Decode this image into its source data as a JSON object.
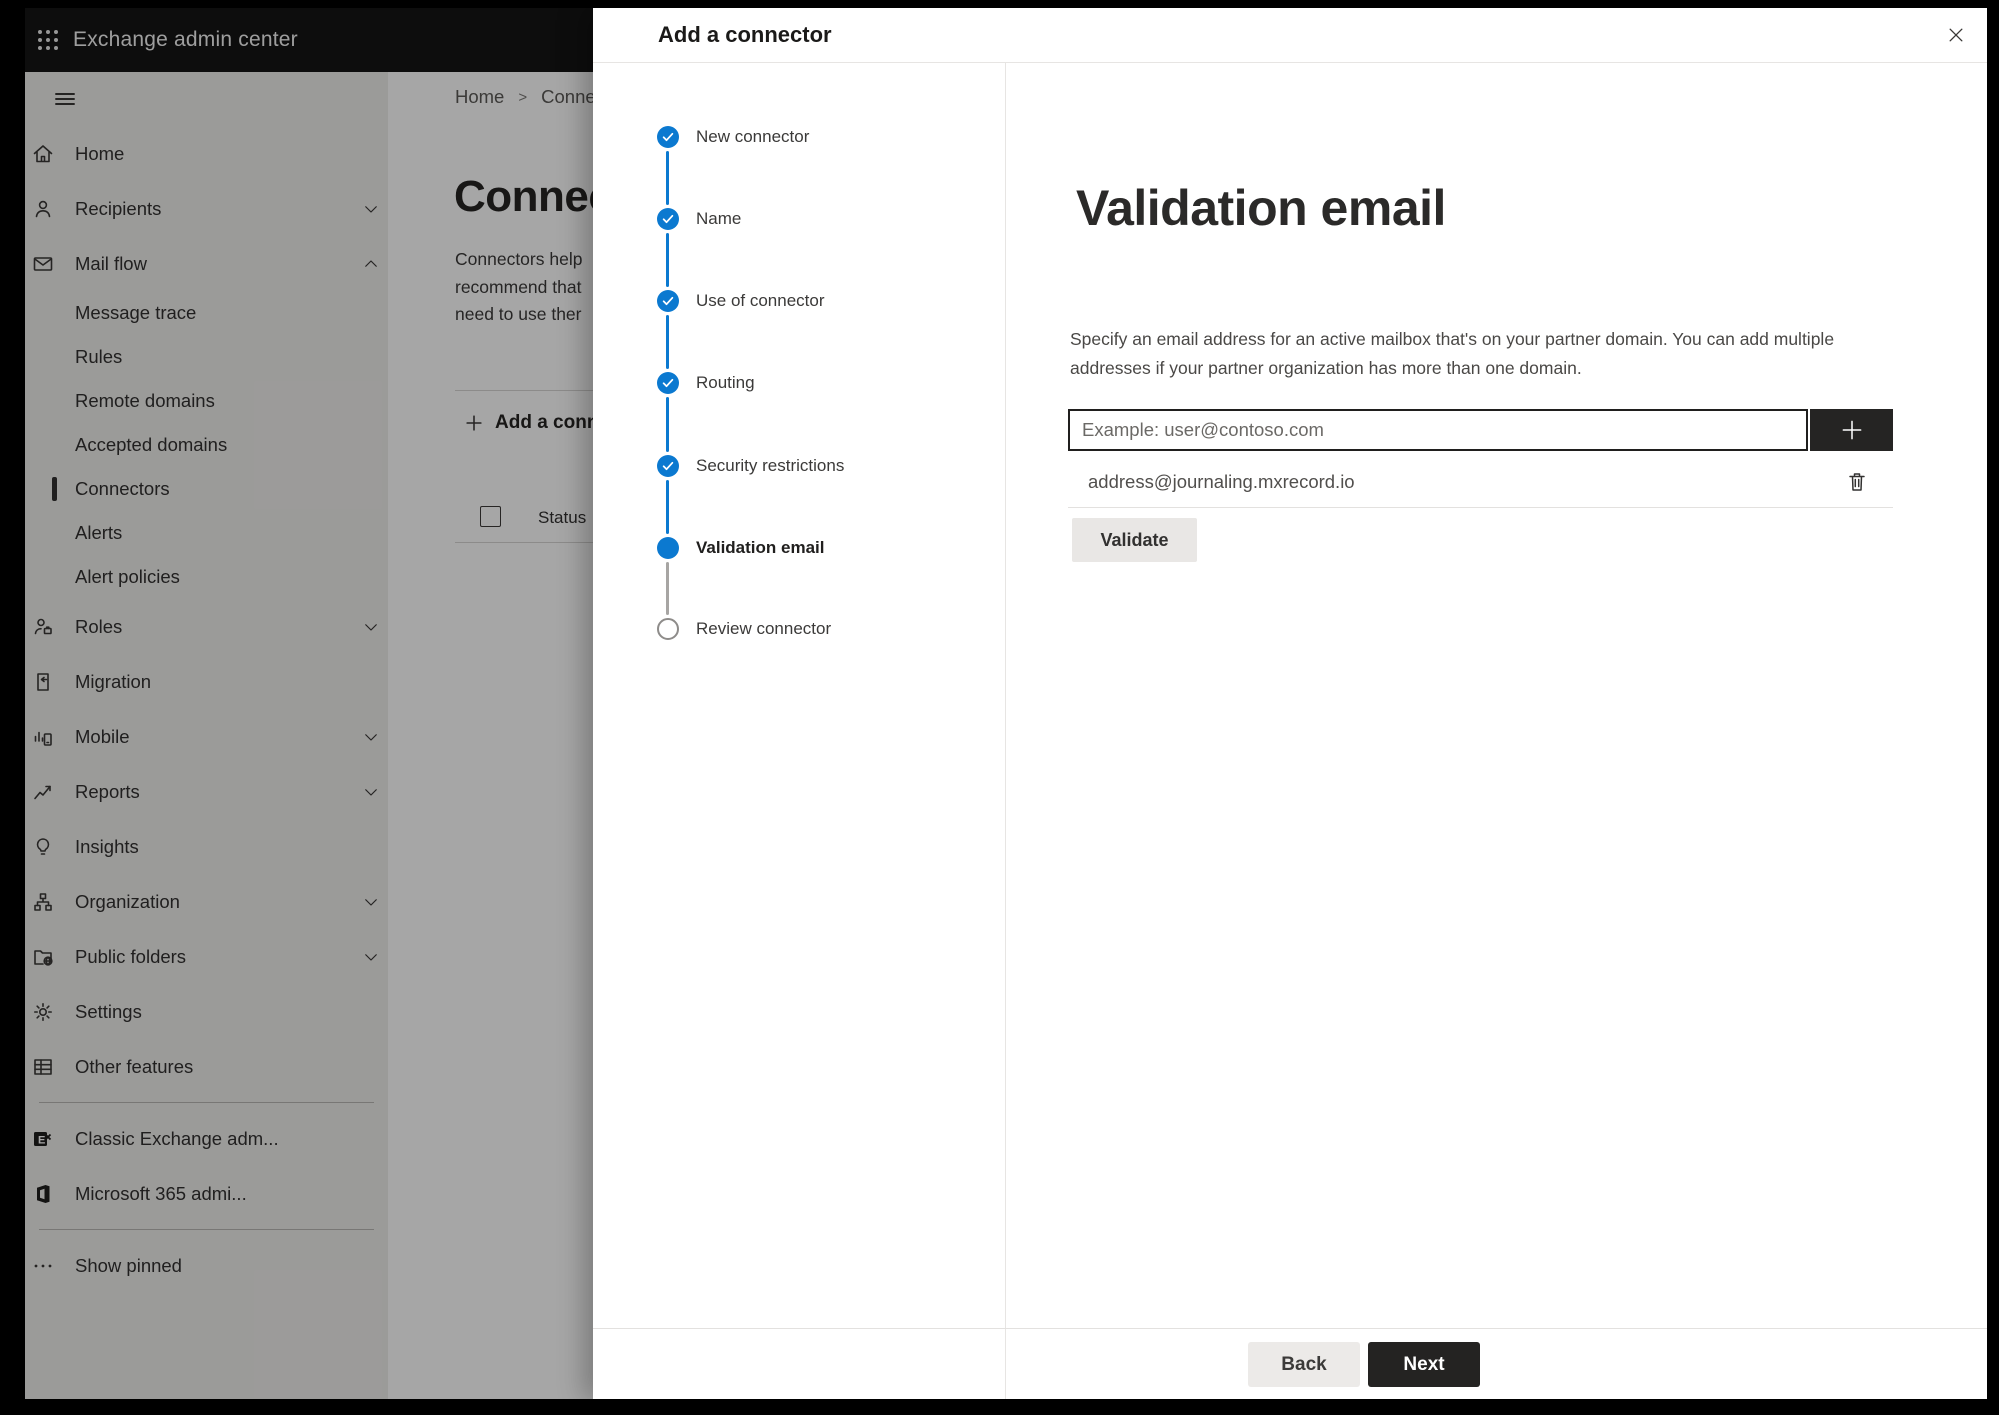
{
  "topbar": {
    "app_title": "Exchange admin center"
  },
  "sidebar": {
    "items": [
      {
        "label": "Home"
      },
      {
        "label": "Recipients"
      },
      {
        "label": "Mail flow"
      },
      {
        "label": "Message trace"
      },
      {
        "label": "Rules"
      },
      {
        "label": "Remote domains"
      },
      {
        "label": "Accepted domains"
      },
      {
        "label": "Connectors",
        "selected": true
      },
      {
        "label": "Alerts"
      },
      {
        "label": "Alert policies"
      },
      {
        "label": "Roles"
      },
      {
        "label": "Migration"
      },
      {
        "label": "Mobile"
      },
      {
        "label": "Reports"
      },
      {
        "label": "Insights"
      },
      {
        "label": "Organization"
      },
      {
        "label": "Public folders"
      },
      {
        "label": "Settings"
      },
      {
        "label": "Other features"
      },
      {
        "label": "Classic Exchange adm..."
      },
      {
        "label": "Microsoft 365 admi..."
      },
      {
        "label": "Show pinned"
      }
    ]
  },
  "background_page": {
    "breadcrumb": {
      "home": "Home",
      "separator": ">",
      "current": "Connectors"
    },
    "title": "Connectors",
    "description_lines": [
      "Connectors help",
      "recommend that",
      "need to use ther"
    ],
    "add_button_label": "Add a connector",
    "table": {
      "status_header": "Status"
    }
  },
  "dialog": {
    "title": "Add a connector",
    "steps": [
      {
        "label": "New connector",
        "state": "completed"
      },
      {
        "label": "Name",
        "state": "completed"
      },
      {
        "label": "Use of connector",
        "state": "completed"
      },
      {
        "label": "Routing",
        "state": "completed"
      },
      {
        "label": "Security restrictions",
        "state": "completed"
      },
      {
        "label": "Validation email",
        "state": "current"
      },
      {
        "label": "Review connector",
        "state": "upcoming"
      }
    ],
    "content": {
      "heading": "Validation email",
      "description": "Specify an email address for an active mailbox that's on your partner domain. You can add multiple addresses if your partner organization has more than one domain.",
      "email_input": {
        "value": "",
        "placeholder": "Example: user@contoso.com"
      },
      "added_addresses": [
        "address@journaling.mxrecord.io"
      ],
      "validate_button": "Validate"
    },
    "footer": {
      "back_button": "Back",
      "next_button": "Next"
    }
  },
  "icons": {
    "app_launcher": "waffle-grid",
    "nav_toggle": "hamburger",
    "close": "x",
    "add_email": "plus",
    "remove_address": "trash",
    "add_connector": "plus",
    "step_done": "checkmark"
  },
  "colors": {
    "accent_blue": "#0b79d0",
    "topbar_bg": "#141414",
    "dark_button": "#252423",
    "sidebar_bg": "#efeeec"
  }
}
